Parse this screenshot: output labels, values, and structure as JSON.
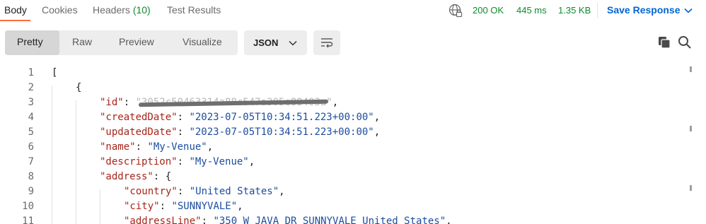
{
  "tabs": {
    "body": "Body",
    "cookies": "Cookies",
    "headers": "Headers",
    "headers_count": "(10)",
    "test_results": "Test Results"
  },
  "status": {
    "code": "200 OK",
    "time": "445 ms",
    "size": "1.35 KB",
    "save_label": "Save Response"
  },
  "toolbar": {
    "views": [
      "Pretty",
      "Raw",
      "Preview",
      "Visualize"
    ],
    "active_view": "Pretty",
    "language": "JSON"
  },
  "icons": {
    "network": "globe-lock-icon",
    "save_dropdown": "chevron-down-icon",
    "language_dropdown": "chevron-down-icon",
    "wrap": "wrap-lines-icon",
    "copy": "copy-icon",
    "search": "search-icon"
  },
  "colors": {
    "status_ok": "#0e8a2e",
    "link_blue": "#0265d2",
    "json_key": "#a8251a",
    "json_string": "#1c4d9e",
    "active_tab_underline": "#ff6c37"
  },
  "editor": {
    "lines": [
      {
        "n": "1",
        "t": "["
      },
      {
        "n": "2",
        "t": "{"
      },
      {
        "n": "3",
        "k": "\"id\"",
        "t": ": ",
        "redacted": "\"3052c50463314a88c547a305e88403a\"",
        "tail": ","
      },
      {
        "n": "4",
        "k": "\"createdDate\"",
        "t": ": ",
        "v": "\"2023-07-05T10:34:51.223+00:00\"",
        "tail": ","
      },
      {
        "n": "5",
        "k": "\"updatedDate\"",
        "t": ": ",
        "v": "\"2023-07-05T10:34:51.223+00:00\"",
        "tail": ","
      },
      {
        "n": "6",
        "k": "\"name\"",
        "t": ": ",
        "v": "\"My-Venue\"",
        "tail": ","
      },
      {
        "n": "7",
        "k": "\"description\"",
        "t": ": ",
        "v": "\"My-Venue\"",
        "tail": ","
      },
      {
        "n": "8",
        "k": "\"address\"",
        "t": ": {"
      },
      {
        "n": "9",
        "k": "\"country\"",
        "t": ": ",
        "v": "\"United States\"",
        "tail": ","
      },
      {
        "n": "10",
        "k": "\"city\"",
        "t": ": ",
        "v": "\"SUNNYVALE\"",
        "tail": ","
      },
      {
        "n": "11",
        "k": "\"addressLine\"",
        "t": ": ",
        "v": "\"350 W JAVA DR SUNNYVALE United States\"",
        "tail": ","
      }
    ]
  }
}
